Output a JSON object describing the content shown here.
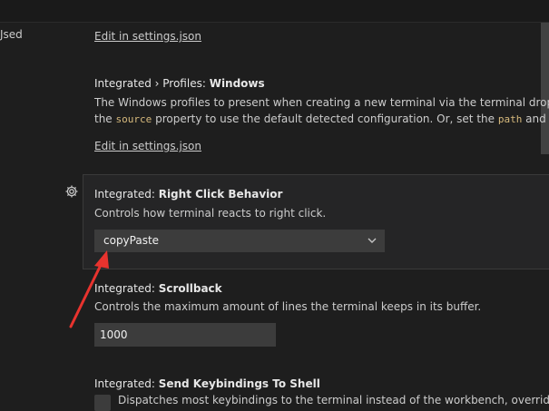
{
  "toc": {
    "partial_item": "Jsed"
  },
  "settings": {
    "edit_link_1": "Edit in settings.json",
    "profiles": {
      "category": "Integrated › Profiles: ",
      "key": "Windows",
      "desc_line1": "The Windows profiles to present when creating a new terminal via the terminal dropdow",
      "desc_line2_a": "the ",
      "desc_line2_code1": "source",
      "desc_line2_b": " property to use the default detected configuration. Or, set the ",
      "desc_line2_code2": "path",
      "desc_line2_c": " and opt"
    },
    "edit_link_2": "Edit in settings.json",
    "right_click": {
      "category": "Integrated: ",
      "key": "Right Click Behavior",
      "desc": "Controls how terminal reacts to right click.",
      "selected_value": "copyPaste"
    },
    "scrollback": {
      "category": "Integrated: ",
      "key": "Scrollback",
      "desc": "Controls the maximum amount of lines the terminal keeps in its buffer.",
      "value": "1000"
    },
    "send_keybindings": {
      "category": "Integrated: ",
      "key": "Send Keybindings To Shell",
      "desc": "Dispatches most keybindings to the terminal instead of the workbench, overriding"
    }
  },
  "colors": {
    "background": "#1e1e1e",
    "focused_panel": "#252526",
    "input_bg": "#3c3c3c",
    "code_text": "#d7ba7d",
    "annotation_arrow": "#e8332e"
  },
  "icons": {
    "gear": "gear-icon",
    "chevron": "chevron-down-icon"
  }
}
